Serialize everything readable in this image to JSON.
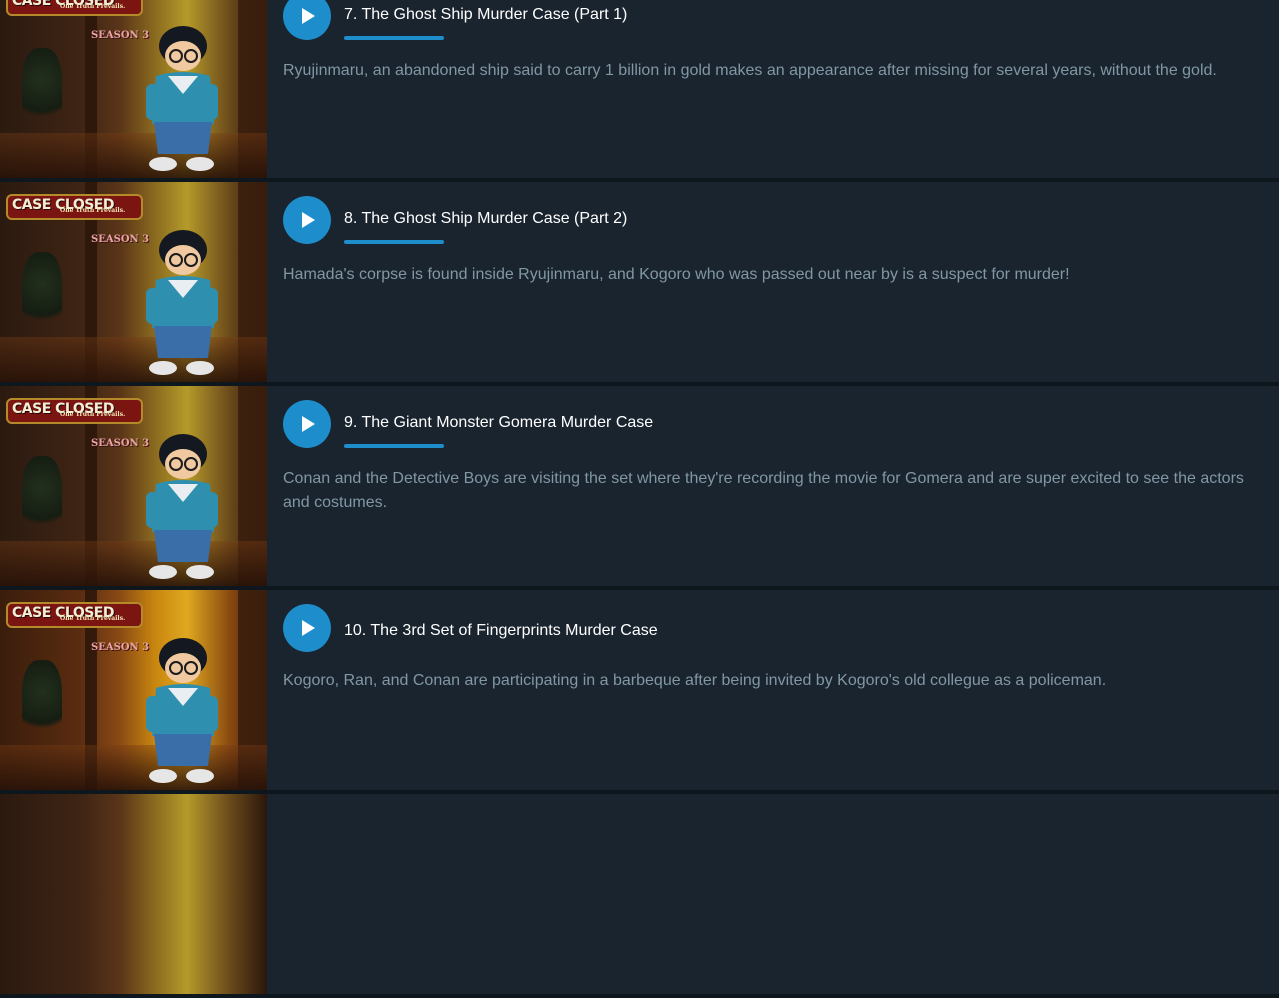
{
  "series": {
    "logo_text": "CASE CLOSED",
    "logo_subtitle": "One Truth Prevails.",
    "season_label": "SEASON 3"
  },
  "colors": {
    "accent": "#1d8ecb",
    "row_background": "#1a242f",
    "title_text": "#ffffff",
    "description_text": "#8197a4"
  },
  "icons": {
    "play": "play-icon"
  },
  "episodes": [
    {
      "title": "7. The Ghost Ship Murder Case (Part 1)",
      "description": "Ryujinmaru, an abandoned ship said to carry 1 billion in gold makes an appearance after missing for several years, without the gold.",
      "progress_visible": true,
      "progress_fraction": 0.1
    },
    {
      "title": "8. The Ghost Ship Murder Case (Part 2)",
      "description": "Hamada's corpse is found inside Ryujinmaru, and Kogoro who was passed out near by is a suspect for murder!",
      "progress_visible": true,
      "progress_fraction": 0.1
    },
    {
      "title": "9. The Giant Monster Gomera Murder Case",
      "description": "Conan and the Detective Boys are visiting the set where they're recording the movie for Gomera and are super excited to see the actors and costumes.",
      "progress_visible": true,
      "progress_fraction": 0.1
    },
    {
      "title": "10. The 3rd Set of Fingerprints Murder Case",
      "description": "Kogoro, Ran, and Conan are participating in a barbeque after being invited by Kogoro's old collegue as a policeman.",
      "progress_visible": false,
      "progress_fraction": 0
    }
  ]
}
